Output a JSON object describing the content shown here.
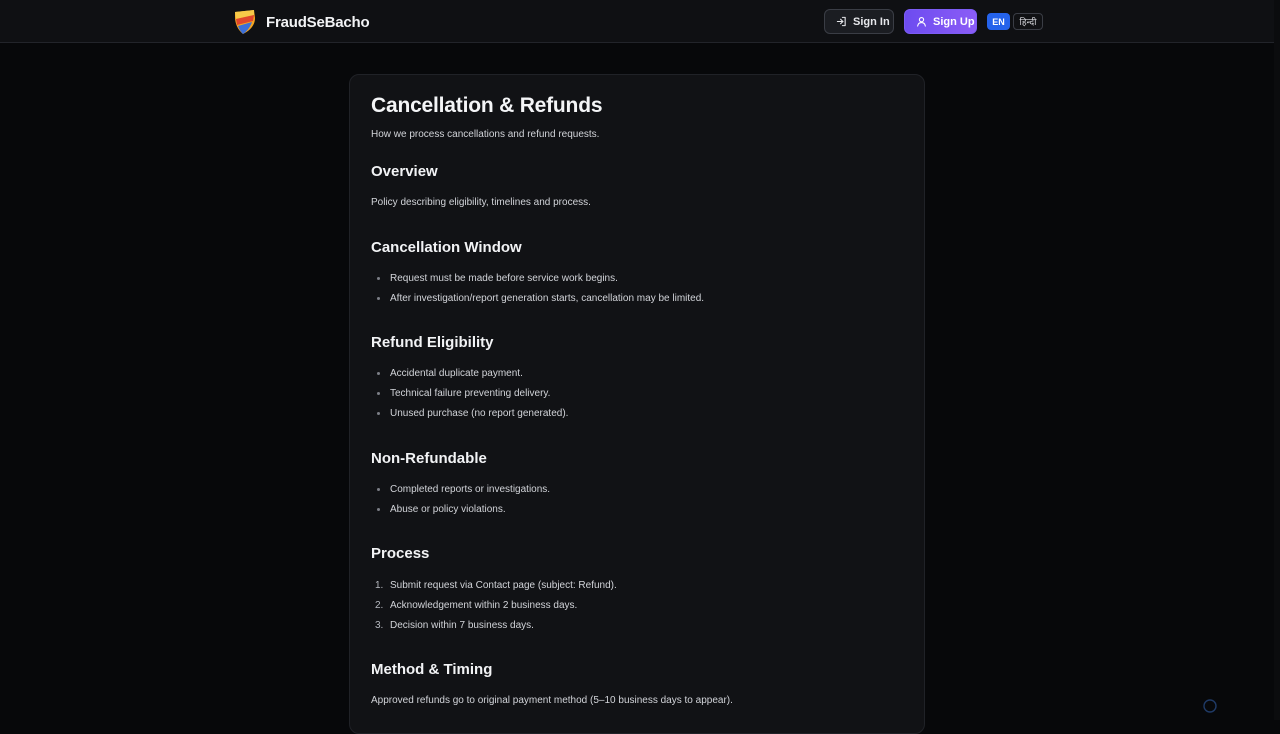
{
  "header": {
    "brand_name": "FraudSeBacho",
    "signin_label": "Sign In",
    "signup_label": "Sign Up",
    "lang_en": "EN",
    "lang_hi": "हिन्दी"
  },
  "page": {
    "title": "Cancellation & Refunds",
    "subtitle": "How we process cancellations and refund requests."
  },
  "sections": {
    "overview": {
      "heading": "Overview",
      "text": "Policy describing eligibility, timelines and process."
    },
    "cancellation": {
      "heading": "Cancellation Window",
      "items": [
        "Request must be made before service work begins.",
        "After investigation/report generation starts, cancellation may be limited."
      ]
    },
    "eligibility": {
      "heading": "Refund Eligibility",
      "items": [
        "Accidental duplicate payment.",
        "Technical failure preventing delivery.",
        "Unused purchase (no report generated)."
      ]
    },
    "nonrefundable": {
      "heading": "Non-Refundable",
      "items": [
        "Completed reports or investigations.",
        "Abuse or policy violations."
      ]
    },
    "process": {
      "heading": "Process",
      "numbers": [
        "1.",
        "2.",
        "3."
      ],
      "items": [
        "Submit request via Contact page (subject: Refund).",
        "Acknowledgement within 2 business days.",
        "Decision within 7 business days."
      ]
    },
    "method": {
      "heading": "Method & Timing",
      "text": "Approved refunds go to original payment method (5–10 business days to appear)."
    }
  },
  "colors": {
    "background": "#07080a",
    "card": "#111215",
    "signup_accent": "#7c5cf4",
    "lang_active": "#2563eb"
  },
  "icons": {
    "logo": "shield-logo-icon",
    "signin": "login-arrow-icon",
    "signup": "user-icon"
  }
}
